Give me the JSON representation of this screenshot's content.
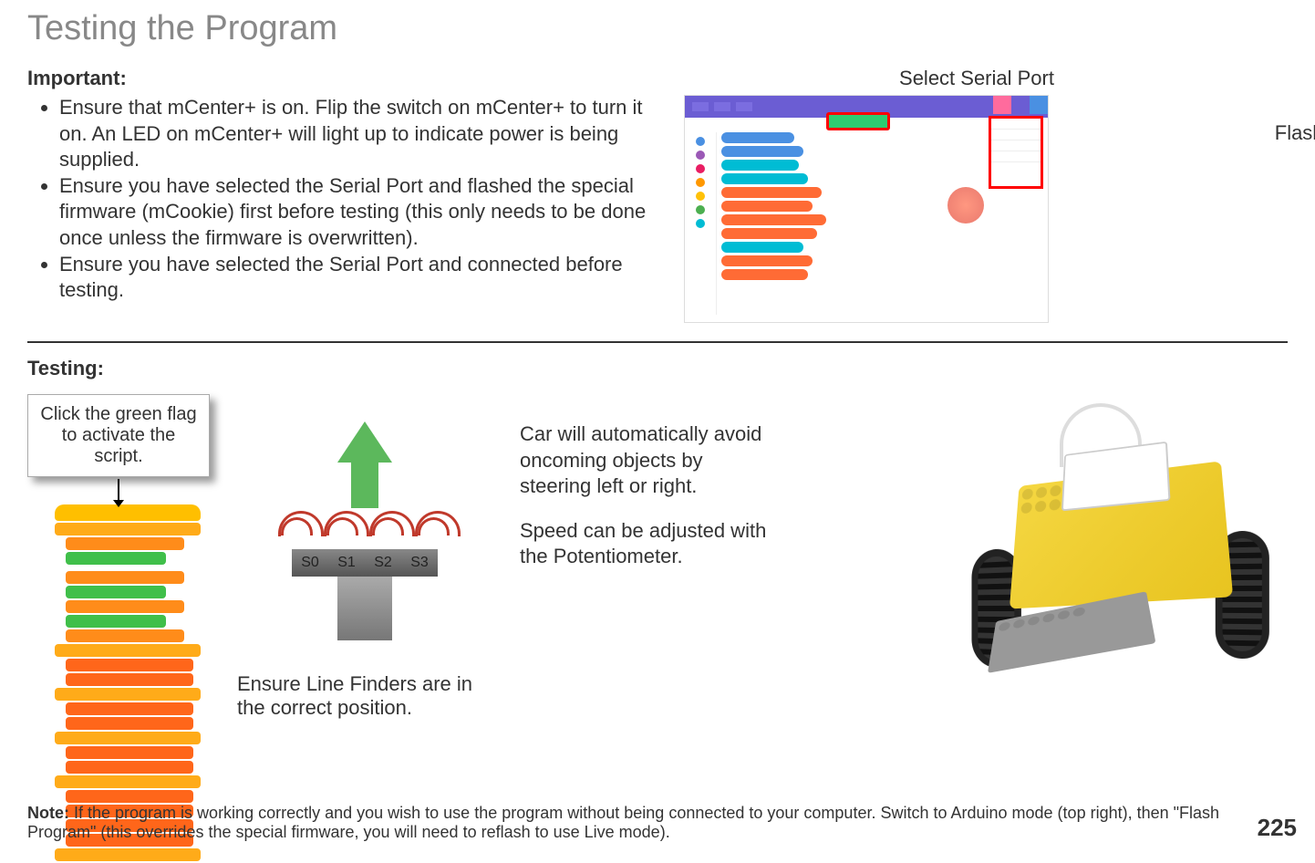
{
  "page": {
    "title": "Testing the Program",
    "number": "225"
  },
  "important": {
    "heading": "Important:",
    "items": [
      "Ensure that mCenter+ is on. Flip the switch on mCenter+ to turn it on. An LED on mCenter+ will light up to indicate power is being supplied.",
      "Ensure you have selected the Serial Port and flashed the special firmware (mCookie) first before testing (this only needs to be done once unless the firmware is overwritten).",
      "Ensure you have selected the Serial Port and connected before testing."
    ]
  },
  "labels": {
    "select_serial": "Select Serial Port",
    "flash_firmware": "Flash firmware"
  },
  "testing": {
    "heading": "Testing:",
    "flag_callout": "Click the green flag to activate the script.",
    "linefinder_caption": "Ensure Line Finders are in the correct position.",
    "sensors": [
      "S0",
      "S1",
      "S2",
      "S3"
    ],
    "desc1": "Car will automatically avoid oncoming objects by steering left or right.",
    "desc2": "Speed can be adjusted with the Potentiometer."
  },
  "note": {
    "bold": "Note: ",
    "text": "If the program is working correctly and you wish to use the program without being connected to your computer. Switch to Arduino mode (top right), then \"Flash Program\" (this overrides the special firmware, you will need to reflash to use Live mode)."
  }
}
